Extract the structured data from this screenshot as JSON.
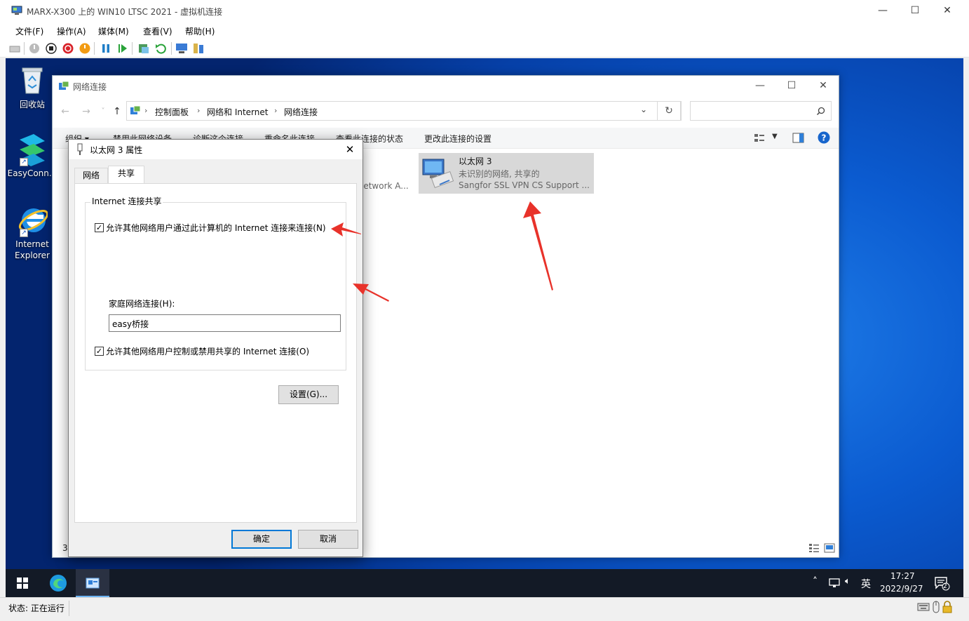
{
  "vm": {
    "title": "MARX-X300 上的 WIN10 LTSC 2021 - 虚拟机连接",
    "menu": [
      "文件(F)",
      "操作(A)",
      "媒体(M)",
      "查看(V)",
      "帮助(H)"
    ],
    "status": "状态: 正在运行"
  },
  "desktop": {
    "icons": [
      {
        "label": "回收站",
        "icon": "recycle-bin-icon"
      },
      {
        "label": "EasyConn...",
        "icon": "easyconnect-icon"
      },
      {
        "label": "Internet Explorer",
        "icon": "internet-explorer-icon"
      }
    ]
  },
  "explorer": {
    "title": "网络连接",
    "breadcrumbs": [
      "控制面板",
      "网络和 Internet",
      "网络连接"
    ],
    "commands": [
      "组织 ▾",
      "禁用此网络设备",
      "诊断这个连接",
      "重命名此连接",
      "查看此连接的状态",
      "更改此连接的设置"
    ],
    "partial_item_text": "letwork A...",
    "status_count_partial": "3",
    "adapter": {
      "name": "以太网 3",
      "status": "未识别的网络, 共享的",
      "device": "Sangfor SSL VPN CS Support ..."
    }
  },
  "dialog": {
    "title": "以太网 3 属性",
    "tabs": [
      "网络",
      "共享"
    ],
    "group_label": "Internet 连接共享",
    "allow_share_label": "允许其他网络用户通过此计算机的 Internet 连接来连接(N)",
    "allow_share_checked": true,
    "home_network_label": "家庭网络连接(H):",
    "home_network_value": "easy桥接",
    "allow_control_label": "允许其他网络用户控制或禁用共享的 Internet 连接(O)",
    "allow_control_checked": true,
    "settings_button": "设置(G)...",
    "ok_button": "确定",
    "cancel_button": "取消"
  },
  "taskbar": {
    "time": "17:27",
    "date": "2022/9/27",
    "ime": "英",
    "notification_count": "2"
  },
  "colors": {
    "accent": "#0078d7",
    "arrow": "#e8322a",
    "taskbar": "#131a26"
  }
}
